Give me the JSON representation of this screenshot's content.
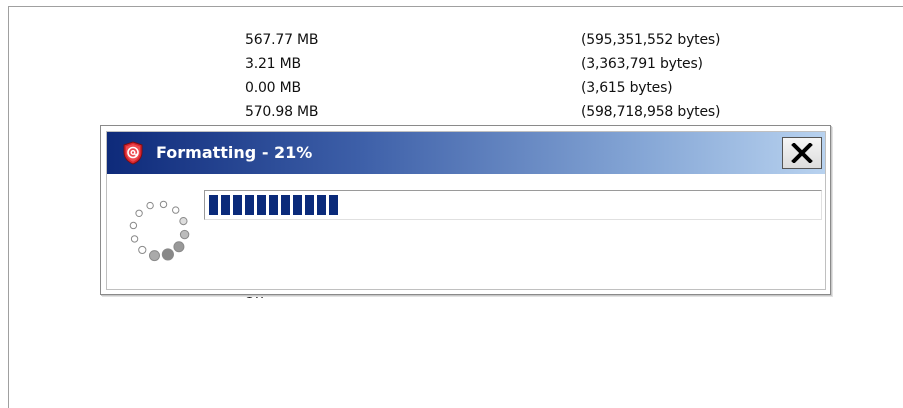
{
  "background": {
    "sizes": [
      {
        "mb": "567.77 MB",
        "bytes": "(595,351,552 bytes)"
      },
      {
        "mb": "3.21 MB",
        "bytes": "(3,363,791 bytes)"
      },
      {
        "mb": "0.00 MB",
        "bytes": "(3,615 bytes)"
      },
      {
        "mb": "570.98 MB",
        "bytes": "(598,718,958 bytes)"
      }
    ],
    "partial_text": "On"
  },
  "dialog": {
    "title": "Formatting - 21%",
    "close_icon": "close-icon",
    "app_icon": "shield-at-icon",
    "spinner_icon": "loading-spinner-icon",
    "progress_percent": 21,
    "colors": {
      "title_gradient_start": "#0e2a7a",
      "title_gradient_end": "#b8d2ef",
      "progress_fill": "#0a2a7a"
    }
  }
}
